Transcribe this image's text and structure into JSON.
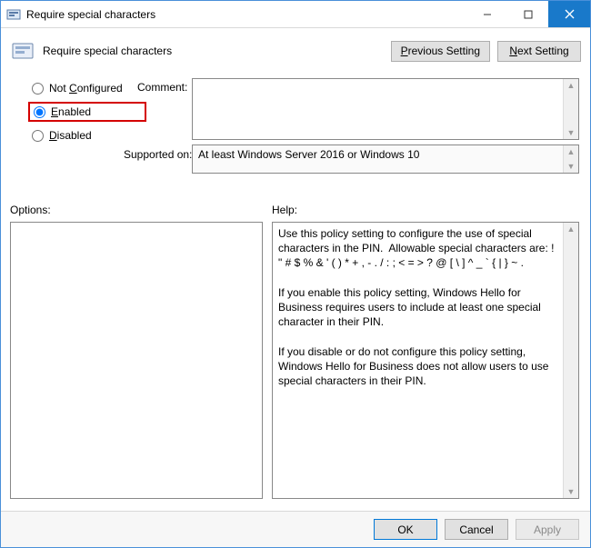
{
  "window": {
    "title": "Require special characters"
  },
  "header": {
    "title": "Require special characters",
    "previous_setting": "Previous Setting",
    "next_setting": "Next Setting"
  },
  "radios": {
    "not_configured": "Not Configured",
    "enabled": "Enabled",
    "disabled": "Disabled",
    "selected": "enabled"
  },
  "labels": {
    "comment": "Comment:",
    "supported_on": "Supported on:",
    "options": "Options:",
    "help": "Help:"
  },
  "fields": {
    "comment": "",
    "supported_on": "At least Windows Server 2016 or Windows 10"
  },
  "help_text": "Use this policy setting to configure the use of special characters in the PIN.  Allowable special characters are: ! \" # $ % & ' ( ) * + , - . / : ; < = > ? @ [ \\ ] ^ _ ` { | } ~ .\n\nIf you enable this policy setting, Windows Hello for Business requires users to include at least one special character in their PIN.\n\nIf you disable or do not configure this policy setting, Windows Hello for Business does not allow users to use special characters in their PIN.",
  "footer": {
    "ok": "OK",
    "cancel": "Cancel",
    "apply": "Apply"
  }
}
